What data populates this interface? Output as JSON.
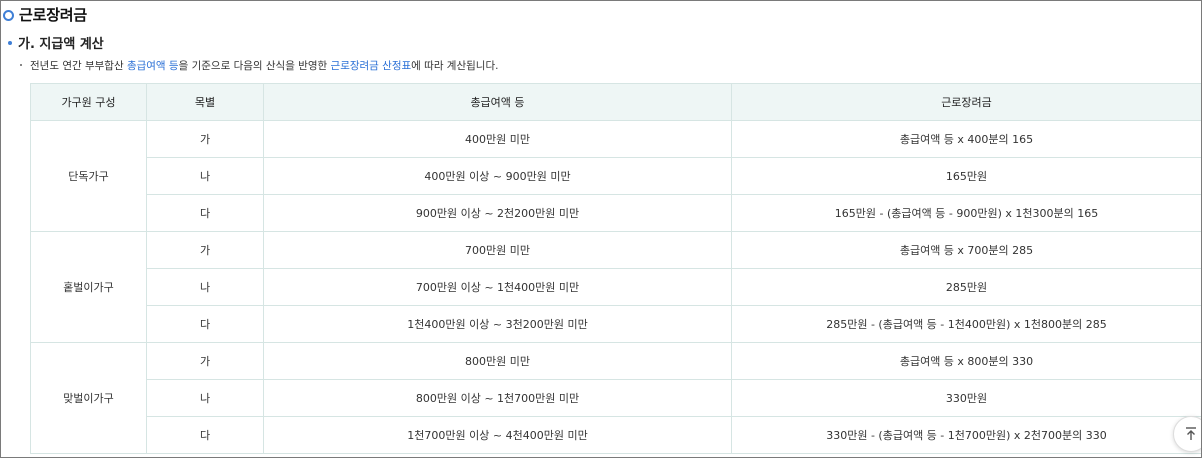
{
  "section_title": "근로장려금",
  "sub_title": "가. 지급액 계산",
  "description": {
    "part1": "전년도 연간 부부합산 ",
    "link1": "총급여액 등",
    "part2": "을 기준으로 다음의 산식을 반영한 ",
    "link2": "근로장려금 산정표",
    "part3": "에 따라 계산됩니다."
  },
  "table": {
    "headers": [
      "가구원 구성",
      "목별",
      "총급여액 등",
      "근로장려금"
    ],
    "groups": [
      {
        "name": "단독가구",
        "rows": [
          {
            "grade": "가",
            "income": "400만원 미만",
            "amount": "총급여액 등 x 400분의 165"
          },
          {
            "grade": "나",
            "income": "400만원 이상 ~ 900만원 미만",
            "amount": "165만원"
          },
          {
            "grade": "다",
            "income": "900만원 이상 ~ 2천200만원 미만",
            "amount": "165만원 - (총급여액 등 - 900만원) x 1천300분의 165"
          }
        ]
      },
      {
        "name": "홑벌이가구",
        "rows": [
          {
            "grade": "가",
            "income": "700만원 미만",
            "amount": "총급여액 등 x 700분의 285"
          },
          {
            "grade": "나",
            "income": "700만원 이상 ~ 1천400만원 미만",
            "amount": "285만원"
          },
          {
            "grade": "다",
            "income": "1천400만원 이상 ~ 3천200만원 미만",
            "amount": "285만원 - (총급여액 등 - 1천400만원) x 1천800분의 285"
          }
        ]
      },
      {
        "name": "맞벌이가구",
        "rows": [
          {
            "grade": "가",
            "income": "800만원 미만",
            "amount": "총급여액 등 x 800분의 330"
          },
          {
            "grade": "나",
            "income": "800만원 이상 ~ 1천700만원 미만",
            "amount": "330만원"
          },
          {
            "grade": "다",
            "income": "1천700만원 이상 ~ 4천400만원 미만",
            "amount": "330만원 - (총급여액 등 - 1천700만원) x 2천700분의 330"
          }
        ]
      }
    ]
  },
  "icons": {
    "title_icon": "ring-bullet-icon",
    "sub_icon": "dot-bullet-icon",
    "scroll_icon": "arrow-up-icon"
  },
  "colors": {
    "accent": "#3f7fd6",
    "link": "#2a6fd6",
    "header_bg": "#eef6f5",
    "border": "#d6e5e3"
  }
}
